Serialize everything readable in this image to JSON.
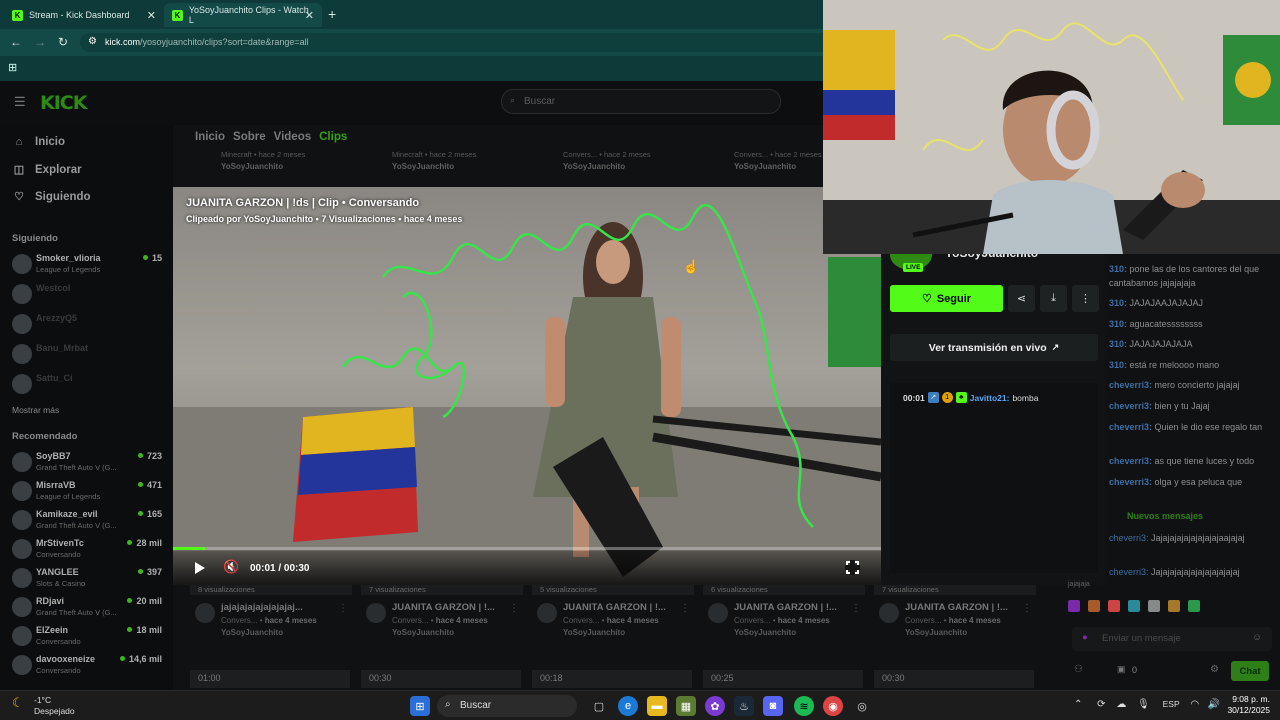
{
  "browser": {
    "tabs": [
      {
        "title": "Stream - Kick Dashboard"
      },
      {
        "title": "YoSoyJuanchito Clips - Watch L"
      }
    ],
    "url_host": "kick.com",
    "url_path": "/yosoyjuanchito/clips?sort=date&range=all"
  },
  "kick": {
    "logo": "KICK",
    "search_placeholder": "Buscar",
    "nav": [
      {
        "label": "Inicio",
        "icon": "home-icon"
      },
      {
        "label": "Explorar",
        "icon": "compass-icon"
      },
      {
        "label": "Siguiendo",
        "icon": "heart-icon"
      }
    ],
    "following_header": "Siguiendo",
    "following": [
      {
        "name": "Smoker_vlioria",
        "category": "League of Legends",
        "viewers": "15"
      },
      {
        "name": "Westcol",
        "category": "",
        "viewers": ""
      },
      {
        "name": "ArezzyQ5",
        "category": "",
        "viewers": ""
      },
      {
        "name": "Banu_Mrbat",
        "category": "",
        "viewers": ""
      },
      {
        "name": "Sattu_Ci",
        "category": "",
        "viewers": ""
      }
    ],
    "show_more": "Mostrar más",
    "recommended_header": "Recomendado",
    "recommended": [
      {
        "name": "SoyBB7",
        "category": "Grand Theft Auto V (G...",
        "viewers": "723"
      },
      {
        "name": "MisrraVB",
        "category": "League of Legends",
        "viewers": "471"
      },
      {
        "name": "Kamikaze_evil",
        "category": "Grand Theft Auto V (G...",
        "viewers": "165"
      },
      {
        "name": "MrStivenTc",
        "category": "Conversando",
        "viewers": "28 mil"
      },
      {
        "name": "YANGLEE",
        "category": "Slots & Casino",
        "viewers": "397"
      },
      {
        "name": "RDjavi",
        "category": "Grand Theft Auto V (G...",
        "viewers": "20 mil"
      },
      {
        "name": "ElZeein",
        "category": "Conversando",
        "viewers": "18 mil"
      },
      {
        "name": "davooxeneize",
        "category": "Conversando",
        "viewers": "14,6 mil"
      }
    ],
    "page_tabs": [
      "Inicio",
      "Sobre",
      "Videos",
      "Clips"
    ],
    "top_row": [
      {
        "meta": "Minecraft • hace 2 meses",
        "channel": "YoSoyJuanchito"
      },
      {
        "meta": "Minecraft • hace 2 meses",
        "channel": "YoSoyJuanchito"
      },
      {
        "meta": "Convers... • hace 2 meses",
        "channel": "YoSoyJuanchito"
      },
      {
        "meta": "Convers... • hace 2 meses",
        "channel": "YoSoyJuanchito"
      }
    ],
    "clip_cards": [
      {
        "views": "8 visualizaciones",
        "title": "jajajajajajajajajaj...",
        "category": "Convers...",
        "ago": "hace 4 meses",
        "channel": "YoSoyJuanchito"
      },
      {
        "views": "7 visualizaciones",
        "title": "JUANITA GARZON | !...",
        "category": "Convers...",
        "ago": "hace 4 meses",
        "channel": "YoSoyJuanchito"
      },
      {
        "views": "5 visualizaciones",
        "title": "JUANITA GARZON | !...",
        "category": "Convers...",
        "ago": "hace 4 meses",
        "channel": "YoSoyJuanchito"
      },
      {
        "views": "6 visualizaciones",
        "title": "JUANITA GARZON | !...",
        "category": "Convers...",
        "ago": "hace 4 meses",
        "channel": "YoSoyJuanchito"
      },
      {
        "views": "7 visualizaciones",
        "title": "JUANITA GARZON | !...",
        "category": "Convers...",
        "ago": "hace 4 meses",
        "channel": "YoSoyJuanchito"
      }
    ],
    "durations": [
      "01:00",
      "00:30",
      "00:18",
      "00:25",
      "00:30"
    ]
  },
  "clip": {
    "title": "JUANITA GARZON | !ds | Clip • Conversando",
    "subtitle": "Clipeado por YoSoyJuanchito • 7 Visualizaciones • hace 4 meses",
    "time": "00:01 / 00:30",
    "progress": 0.045
  },
  "stream_panel": {
    "name": "YoSoyJuanchito",
    "live": "LIVE",
    "follow": "Seguir",
    "watch_live": "Ver transmisión en vivo",
    "chat_time": "00:01",
    "chat_user": "Javitto21:",
    "chat_msg": "bomba"
  },
  "chat": {
    "messages": [
      {
        "user": "310:",
        "text": "pone las de los cantores del que cantabamos jajajajaja"
      },
      {
        "user": "310:",
        "text": "JAJAJAAJAJAJAJ"
      },
      {
        "user": "310:",
        "text": "aguacatessssssss"
      },
      {
        "user": "310:",
        "text": "JAJAJAJAJAJA"
      },
      {
        "user": "310:",
        "text": "está re meloooo mano"
      },
      {
        "user": "cheverri3:",
        "text": "mero concierto jajajaj"
      },
      {
        "user": "cheverri3:",
        "text": "bien y tu Jajaj"
      },
      {
        "user": "cheverri3:",
        "text": "Quien le dio ese regalo tan"
      },
      {
        "user": "cheverri3:",
        "text": "as que tiene luces y todo"
      },
      {
        "user": "cheverri3:",
        "text": "olga y esa peluca que"
      }
    ],
    "new_messages": "Nuevos mensajes",
    "after": [
      {
        "user": "cheverri3:",
        "text": "Jajajajajajajajajajaajajaj"
      },
      {
        "user": "cheverri3:",
        "text": "Jajajajajajajajajajajajaj"
      }
    ],
    "input_placeholder": "Enviar un mensaje",
    "count": "0",
    "send": "Chat"
  },
  "taskbar": {
    "temp": "-1°C",
    "weather": "Despejado",
    "search": "Buscar",
    "lang": "ESP",
    "time": "9:08 p. m.",
    "date": "30/12/2025"
  },
  "colors": {
    "kick_green": "#53fc18",
    "teal_chrome": "#134a48"
  }
}
